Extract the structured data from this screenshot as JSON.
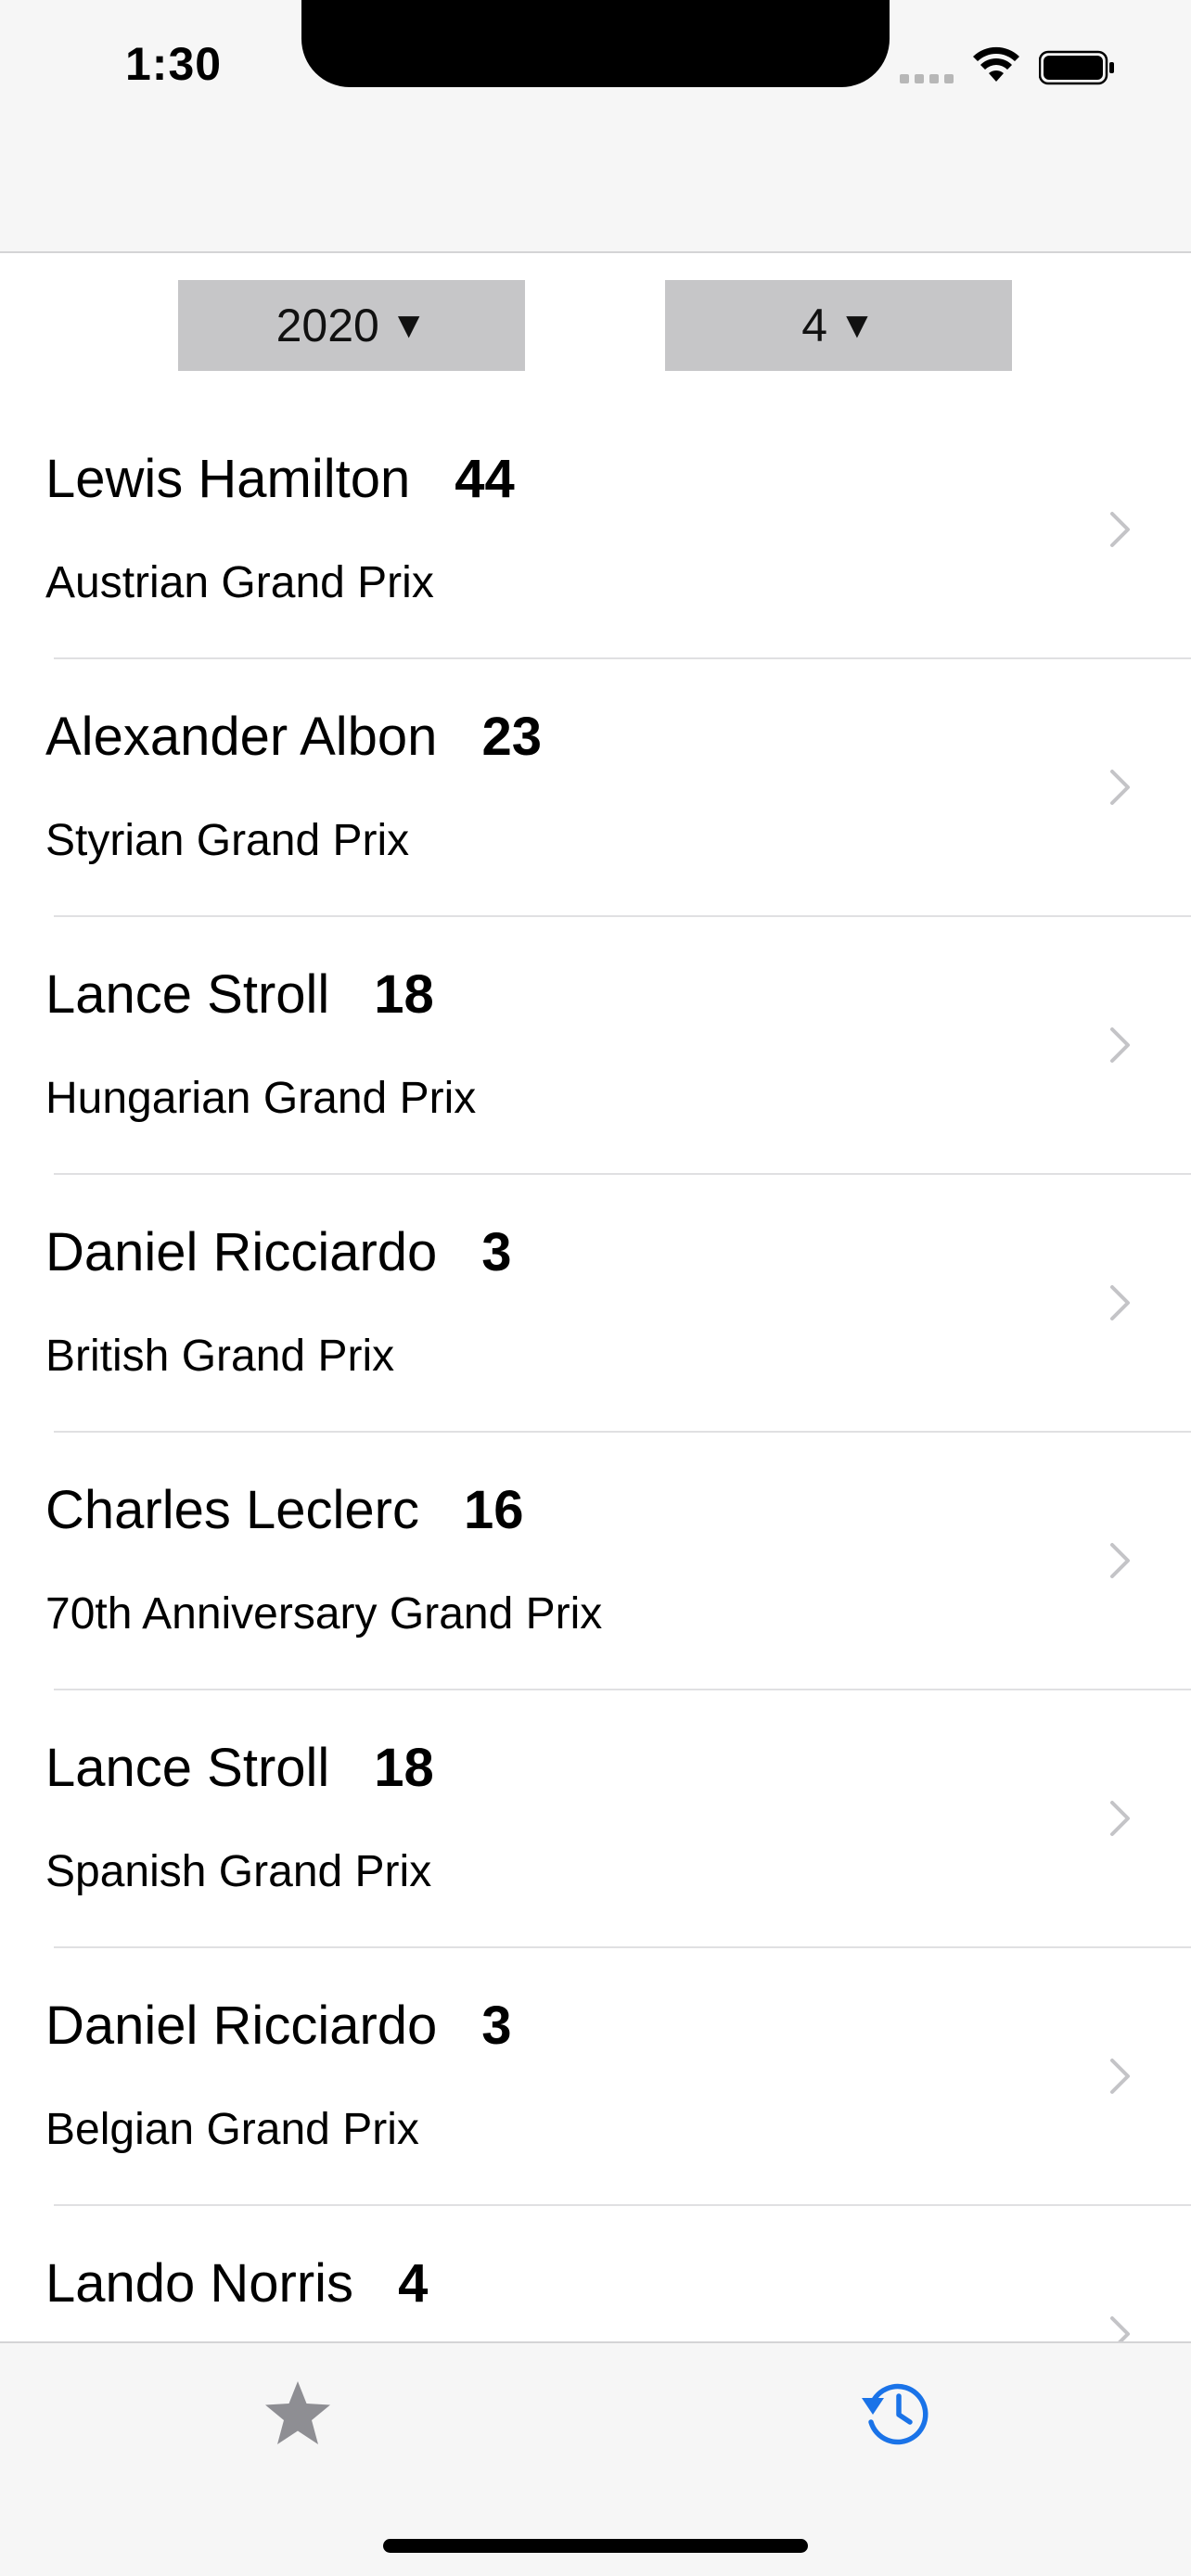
{
  "status_bar": {
    "time": "1:30"
  },
  "pickers": {
    "year": "2020",
    "round": "4",
    "dropdown_glyph": "▼"
  },
  "list": {
    "items": [
      {
        "driver": "Lewis Hamilton",
        "number": "44",
        "race": "Austrian Grand Prix"
      },
      {
        "driver": "Alexander Albon",
        "number": "23",
        "race": "Styrian Grand Prix"
      },
      {
        "driver": "Lance Stroll",
        "number": "18",
        "race": "Hungarian Grand Prix"
      },
      {
        "driver": "Daniel Ricciardo",
        "number": "3",
        "race": "British Grand Prix"
      },
      {
        "driver": "Charles Leclerc",
        "number": "16",
        "race": "70th Anniversary Grand Prix"
      },
      {
        "driver": "Lance Stroll",
        "number": "18",
        "race": "Spanish Grand Prix"
      },
      {
        "driver": "Daniel Ricciardo",
        "number": "3",
        "race": "Belgian Grand Prix"
      },
      {
        "driver": "Lando Norris",
        "number": "4",
        "race": ""
      }
    ]
  },
  "tab_bar": {
    "tabs": [
      {
        "icon": "star-icon",
        "selected": false,
        "color": "#8e8e93"
      },
      {
        "icon": "history-icon",
        "selected": true,
        "color": "#1a73e8"
      }
    ]
  },
  "colors": {
    "accent": "#1a73e8",
    "picker_bg": "#c6c6c8",
    "chevron": "#c4c4c7"
  }
}
